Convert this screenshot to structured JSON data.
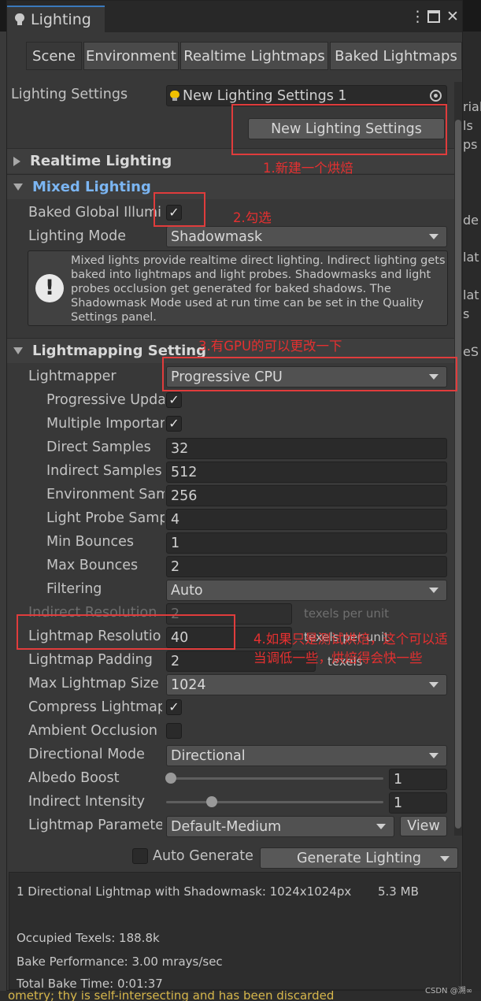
{
  "window": {
    "title": "Lighting",
    "tabs": [
      "Scene",
      "Environment",
      "Realtime Lightmaps",
      "Baked Lightmaps"
    ]
  },
  "background_fragments": {
    "right": [
      "rial",
      "ls",
      "ps",
      "de",
      "lat",
      "lat",
      "s",
      "eS"
    ],
    "bottom": "ometry; thy is self-intersecting and has been discarded"
  },
  "lighting_settings": {
    "label": "Lighting Settings",
    "asset": "New Lighting Settings 1",
    "new_button": "New Lighting Settings"
  },
  "sections": {
    "realtime": "Realtime Lighting",
    "mixed": "Mixed Lighting",
    "lightmapping": "Lightmapping Setting"
  },
  "mixed": {
    "baked_gi_label": "Baked Global Illumi",
    "baked_gi_checked": true,
    "mode_label": "Lighting Mode",
    "mode_value": "Shadowmask",
    "info_text": "Mixed lights provide realtime direct lighting. Indirect lighting gets baked into lightmaps and light probes. Shadowmasks and light probes occlusion get generated for baked shadows. The Shadowmask Mode used at run time can be set in the Quality Settings panel."
  },
  "lightmapping": {
    "lightmapper_label": "Lightmapper",
    "lightmapper_value": "Progressive CPU",
    "progressive_updates_label": "Progressive Upda",
    "multiple_importance_label": "Multiple Importan",
    "direct_samples_label": "Direct Samples",
    "direct_samples": "32",
    "indirect_samples_label": "Indirect Samples",
    "indirect_samples": "512",
    "env_samples_label": "Environment Sam",
    "env_samples": "256",
    "probe_samples_label": "Light Probe Samp",
    "probe_samples": "4",
    "min_bounces_label": "Min Bounces",
    "min_bounces": "1",
    "max_bounces_label": "Max Bounces",
    "max_bounces": "2",
    "filtering_label": "Filtering",
    "filtering": "Auto",
    "indirect_res_label": "Indirect Resolution",
    "indirect_res": "2",
    "texels_unit": "texels per unit",
    "lightmap_res_label": "Lightmap Resolutio",
    "lightmap_res": "40",
    "padding_label": "Lightmap Padding",
    "padding": "2",
    "padding_unit": "texels",
    "max_size_label": "Max Lightmap Size",
    "max_size": "1024",
    "compress_label": "Compress Lightmap",
    "ao_label": "Ambient Occlusion",
    "directional_label": "Directional Mode",
    "directional": "Directional",
    "albedo_label": "Albedo Boost",
    "albedo": "1",
    "albedo_level": 0.0,
    "indirect_intensity_label": "Indirect Intensity",
    "indirect_intensity": "1",
    "indirect_intensity_level": 0.2,
    "params_label": "Lightmap Paramete",
    "params": "Default-Medium",
    "view_button": "View"
  },
  "footer": {
    "auto_generate": "Auto Generate",
    "generate_button": "Generate Lighting",
    "stats": {
      "lightmap_line": "1 Directional Lightmap with Shadowmask: 1024x1024px",
      "lightmap_size": "5.3 MB",
      "occupied": "Occupied Texels: 188.8k",
      "performance": "Bake Performance: 3.00 mrays/sec",
      "total_time": "Total Bake Time: 0:01:37"
    }
  },
  "annotations": {
    "a1": "1.新建一个烘焙",
    "a2": "2.勾选",
    "a3": "3.有GPU的可以更改一下",
    "a4_line1": "4.如果只是测试烘焙，这个可以适",
    "a4_line2": "当调低一些，烘焙得会快一些",
    "color": "#e03c3c"
  },
  "watermark": "CSDN @溯∞"
}
